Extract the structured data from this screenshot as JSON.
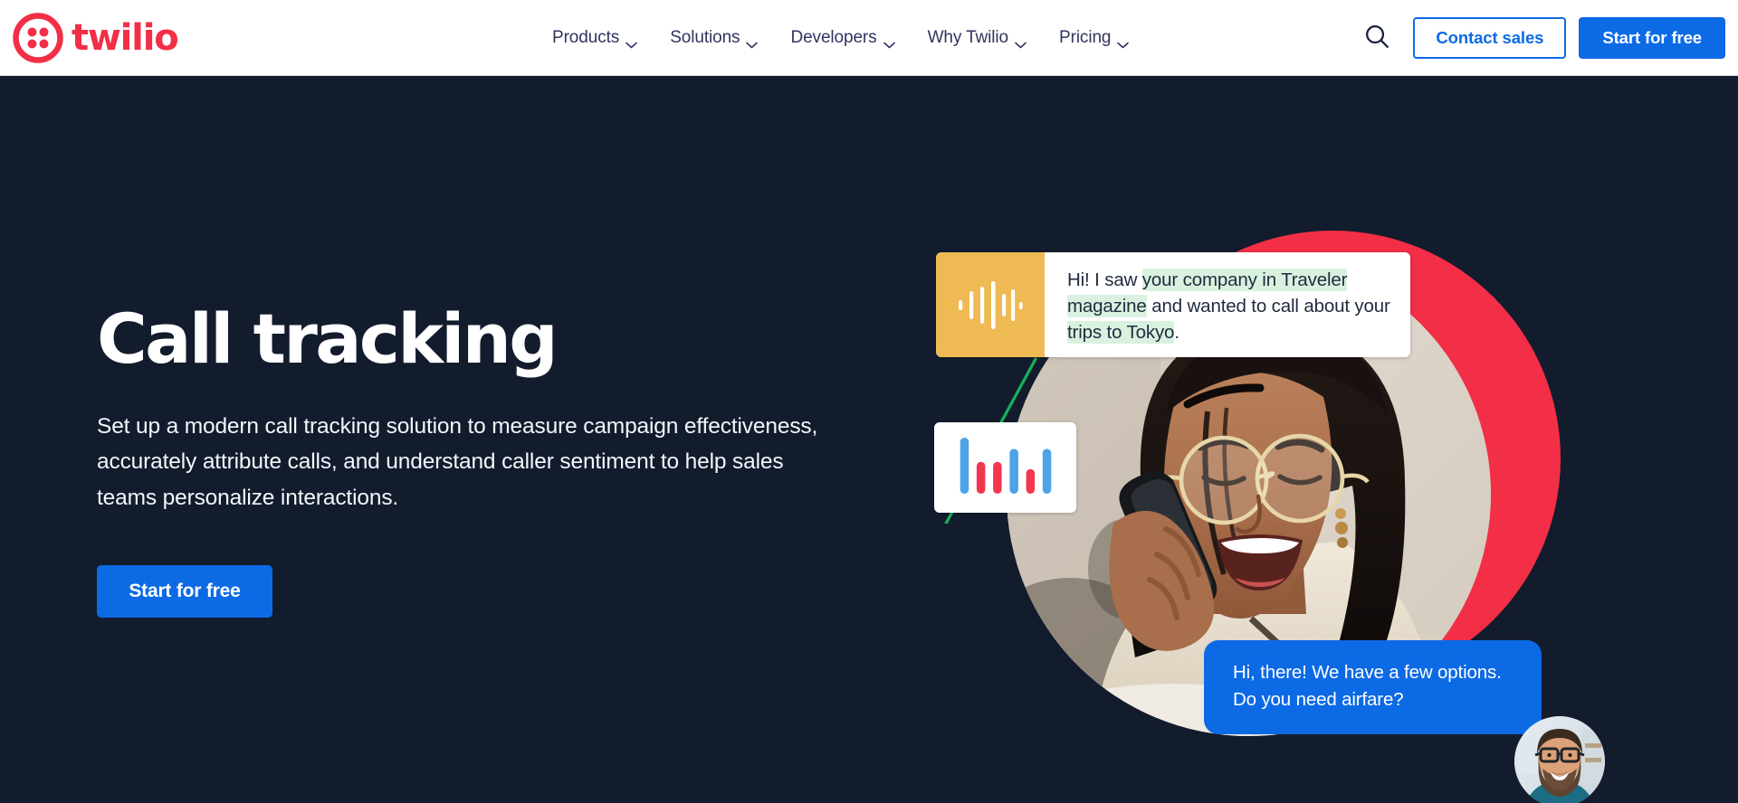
{
  "brand": {
    "name": "twilio",
    "logo_icon": "twilio-logo-icon",
    "color": "#F22F46"
  },
  "header": {
    "nav_items": [
      {
        "label": "Products",
        "icon": "chevron-down-icon"
      },
      {
        "label": "Solutions",
        "icon": "chevron-down-icon"
      },
      {
        "label": "Developers",
        "icon": "chevron-down-icon"
      },
      {
        "label": "Why Twilio",
        "icon": "chevron-down-icon"
      },
      {
        "label": "Pricing",
        "icon": "chevron-down-icon"
      }
    ],
    "search_icon": "search-icon",
    "contact_sales_label": "Contact sales",
    "start_free_label": "Start for free",
    "accent_blue": "#0D6AE5",
    "nav_text_color": "#30355E"
  },
  "hero": {
    "title": "Call tracking",
    "subtitle": "Set up a modern call tracking solution to measure campaign effectiveness, accurately attribute calls, and understand caller sentiment to help sales teams personalize interactions.",
    "cta_label": "Start for free",
    "background_color": "#121C2D"
  },
  "art": {
    "red_circle_color": "#F22F46",
    "connector_line_color": "#13B35A",
    "transcript": {
      "waveform_icon": "audio-waveform-icon",
      "waveform_bg": "#EFB954",
      "full_text": "Hi! I saw your company in Traveler magazine and wanted to call about your trips to Tokyo.",
      "segments": [
        {
          "text": "Hi! I saw ",
          "highlight": false
        },
        {
          "text": "your company in Traveler magazine",
          "highlight": true
        },
        {
          "text": " and wanted to call about your ",
          "highlight": false
        },
        {
          "text": "trips to Tokyo",
          "highlight": true
        },
        {
          "text": ".",
          "highlight": false
        }
      ],
      "highlight_color": "#d9f2df"
    },
    "chart_card": {
      "icon": "bar-chart-icon",
      "bars": [
        {
          "height_pct": 100,
          "color": "#4DA3E8"
        },
        {
          "height_pct": 57,
          "color": "#F2374F"
        },
        {
          "height_pct": 57,
          "color": "#F2374F"
        },
        {
          "height_pct": 80,
          "color": "#4DA3E8"
        },
        {
          "height_pct": 44,
          "color": "#F2374F"
        },
        {
          "height_pct": 80,
          "color": "#4DA3E8"
        }
      ]
    },
    "chat_bubble": {
      "text": "Hi, there! We have a few options. Do you need airfare?",
      "background": "#0D6AE5"
    },
    "photo": {
      "alt": "woman-on-phone-photo",
      "name": "hero-photo"
    },
    "avatar": {
      "alt": "agent-avatar-photo",
      "name": "agent-avatar"
    }
  }
}
